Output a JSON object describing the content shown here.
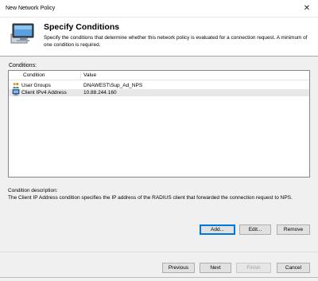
{
  "window": {
    "title": "New Network Policy"
  },
  "header": {
    "heading": "Specify Conditions",
    "description": "Specify the conditions that determine whether this network policy is evaluated for a connection request. A minimum of one condition is required."
  },
  "conditions": {
    "label": "Conditions:",
    "columns": [
      "Condition",
      "Value"
    ],
    "rows": [
      {
        "condition": "User Groups",
        "value": "DNAWEST\\Sup_Ad_NPS",
        "icon": "user-groups-icon"
      },
      {
        "condition": "Client IPv4 Address",
        "value": "10.88.244.160",
        "icon": "client-computer-icon"
      }
    ]
  },
  "condition_description": {
    "label": "Condition description:",
    "text": "The Client IP Address condition specifies the IP address of the RADIUS client that forwarded the connection request to NPS."
  },
  "actions": {
    "add": "Add...",
    "edit": "Edit...",
    "remove": "Remove"
  },
  "nav": {
    "previous": "Previous",
    "next": "Next",
    "finish": "Finish",
    "cancel": "Cancel"
  },
  "colors": {
    "selected_row": "#e8e8e8",
    "default_button_border": "#0078d7",
    "dialog_bg": "#f0f0f0"
  }
}
